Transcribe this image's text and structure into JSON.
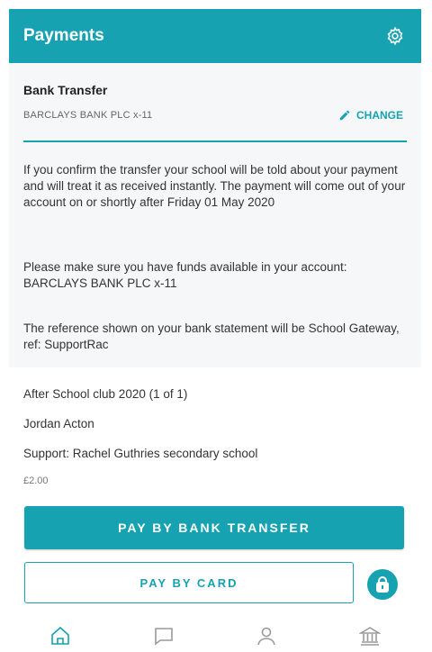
{
  "header": {
    "title": "Payments",
    "settings_icon": "gear-icon"
  },
  "bank": {
    "title": "Bank Transfer",
    "account": "BARCLAYS BANK PLC x-11",
    "change_label": "CHANGE"
  },
  "info": {
    "para1": "If you confirm the transfer your school will be told about your payment and will treat it as received instantly. The payment will come out of your account on or shortly after Friday 01 May 2020",
    "para2": "Please make sure you have funds available in your account: BARCLAYS BANK PLC x-11",
    "para3": "The reference shown on your bank statement will be School Gateway, ref: SupportRac"
  },
  "item": {
    "name": "After School club 2020 (1 of 1)",
    "student": "Jordan Acton",
    "school": "Support: Rachel Guthries secondary school",
    "amount": "£2.00"
  },
  "actions": {
    "pay_bank_label": "PAY BY BANK TRANSFER",
    "pay_card_label": "PAY BY CARD"
  },
  "nav": {
    "items": [
      {
        "icon": "home-icon"
      },
      {
        "icon": "message-icon"
      },
      {
        "icon": "profile-icon"
      },
      {
        "icon": "bank-icon"
      }
    ]
  },
  "colors": {
    "accent": "#17a2b1",
    "panel": "#f6f7f8"
  }
}
